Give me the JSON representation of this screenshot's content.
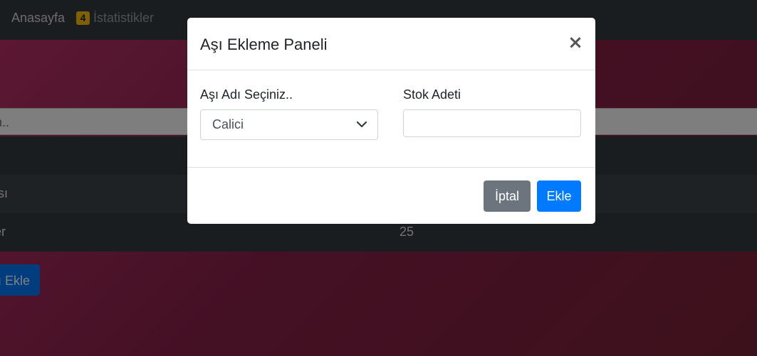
{
  "navbar": {
    "home_label": "Anasayfa",
    "stats_badge": "4",
    "stats_label": "İstatistikler"
  },
  "background": {
    "search_text": "n..",
    "rows": [
      {
        "name": "ısı",
        "value": ""
      },
      {
        "name": "er",
        "value": "25"
      }
    ],
    "add_button_label": "ı Ekle"
  },
  "modal": {
    "title": "Aşı Ekleme Paneli",
    "close_symbol": "×",
    "vaccine_label": "Aşı Adı Seçiniz..",
    "vaccine_selected": "Calici",
    "stock_label": "Stok Adeti",
    "stock_value": "",
    "cancel_label": "İptal",
    "add_label": "Ekle"
  },
  "colors": {
    "primary": "#007bff",
    "secondary": "#6c757d",
    "badge": "#ffc107",
    "navbar": "#343a40"
  }
}
